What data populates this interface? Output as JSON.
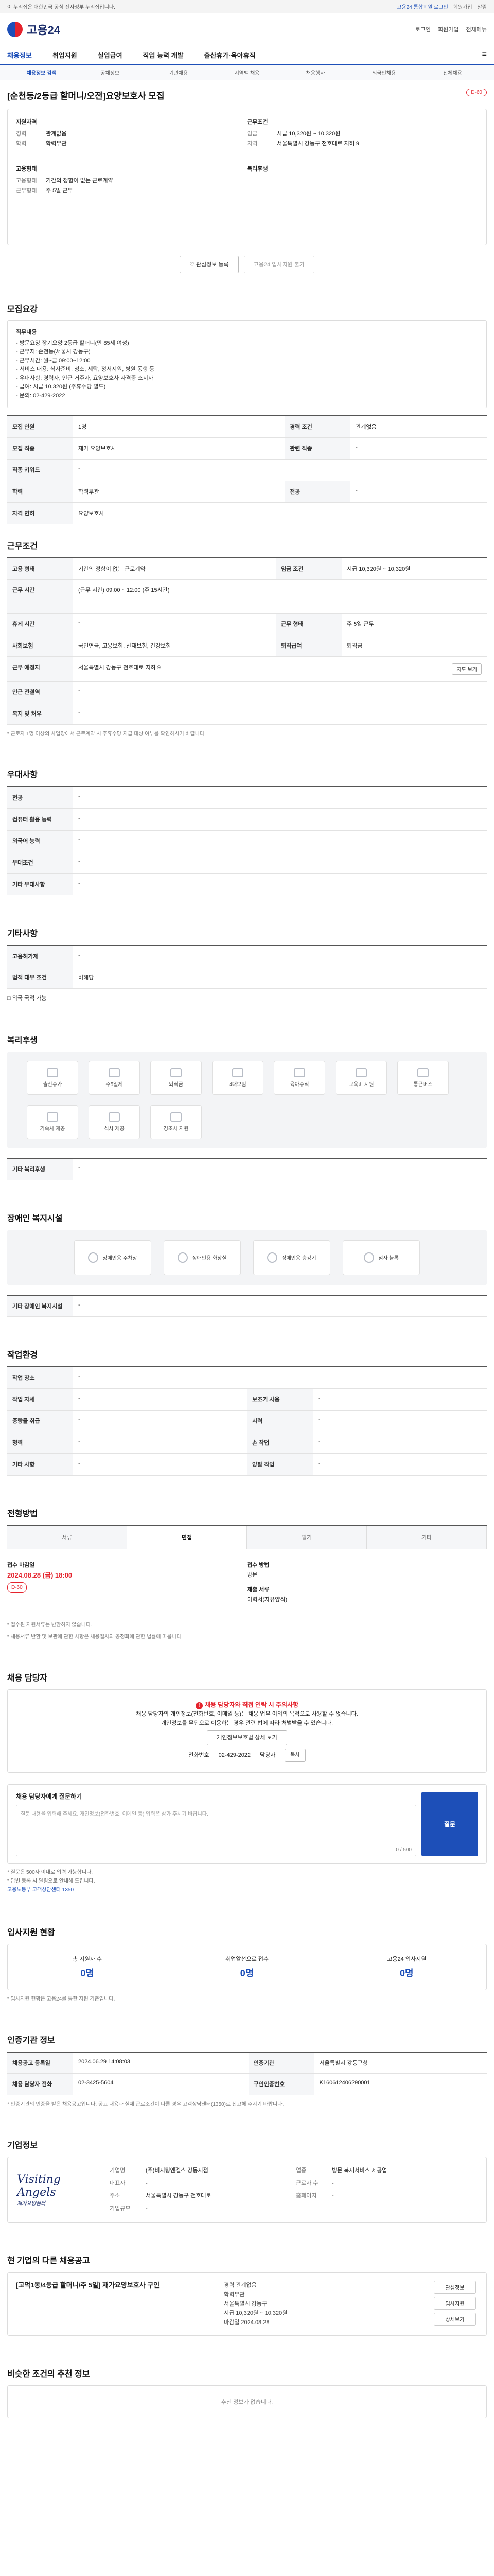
{
  "topbar": {
    "left": "이 누리집은 대한민국 공식 전자정부 누리집입니다.",
    "right": [
      "고용24 통합회원 로그인",
      "회원가입",
      "알림"
    ]
  },
  "header": {
    "logo_text": "고용24",
    "right_links": [
      "로그인",
      "회원가입",
      "전체메뉴"
    ]
  },
  "nav": {
    "items": [
      "채용정보",
      "취업지원",
      "실업급여",
      "직업 능력 개발",
      "출산휴가·육아휴직"
    ],
    "hamburger": "≡"
  },
  "subnav": {
    "items": [
      "채용정보 검색",
      "공채정보",
      "기관채용",
      "지역별 채용",
      "채용행사",
      "외국인채용",
      "전체채용"
    ]
  },
  "job": {
    "title": "[순천동/2등급 할머니/오전]요양보호사 모집",
    "badge": "D-60"
  },
  "summary": {
    "left": {
      "h1": "지원자격",
      "rows1": [
        [
          "경력",
          "관계없음"
        ],
        [
          "학력",
          "학력무관"
        ]
      ],
      "h2": "고용형태",
      "rows2": [
        [
          "고용형태",
          "기간의 정함이 없는 근로계약"
        ],
        [
          "근무형태",
          "주 5일 근무"
        ]
      ]
    },
    "right": {
      "h1": "근무조건",
      "rows1": [
        [
          "임금",
          "시급 10,320원 ~ 10,320원"
        ],
        [
          "지역",
          "서울특별시 강동구 천호대로 지하 9"
        ]
      ],
      "h2": "복리후생",
      "rows2": []
    }
  },
  "actions": {
    "save": "♡ 관심정보 등록",
    "compare": "고용24 입사지원 불가"
  },
  "detail": {
    "section_title": "모집요강",
    "job_desc_h": "직무내용",
    "job_desc_lines": [
      "- 방문요양 장기요양 2등급 할머니(만 85세 여성)",
      "- 근무지: 순천동(서울시 강동구)",
      "- 근무시간: 월~금 09:00~12:00",
      "- 서비스 내용: 식사준비, 청소, 세탁, 정서지원, 병원 동행 등",
      "- 우대사항: 경력자, 인근 거주자, 요양보호사 자격증 소지자",
      "- 급여: 시급 10,320원 (주휴수당 별도)",
      "- 문의: 02-429-2022"
    ],
    "rows": [
      [
        "모집 인원",
        "1명",
        "경력 조건",
        "관계없음"
      ],
      [
        "모집 직종",
        "재가 요양보호사",
        "관련 직종",
        "-"
      ],
      [
        "직종 키워드",
        "-",
        "",
        ""
      ],
      [
        "학력",
        "학력무관",
        "전공",
        "-"
      ],
      [
        "자격 면허",
        "요양보호사",
        "",
        ""
      ]
    ]
  },
  "conditions": {
    "section_title": "근무조건",
    "rows": [
      [
        "고용 형태",
        "기간의 정함이 없는 근로계약",
        "임금 조건",
        "시급 10,320원 ~ 10,320원"
      ],
      [
        "근무 시간",
        "(근무 시간) 09:00 ~ 12:00 (주 15시간)",
        "",
        ""
      ],
      [
        "휴게 시간",
        "-",
        "근무 형태",
        "주 5일 근무"
      ],
      [
        "사회보험",
        "국민연금, 고용보험, 산재보험, 건강보험",
        "퇴직급여",
        "퇴직금"
      ],
      [
        "근무 예정지",
        "서울특별시 강동구 천호대로 지하 9",
        "",
        ""
      ],
      [
        "인근 전철역",
        "-",
        "",
        ""
      ],
      [
        "복지 및 처우",
        "-",
        "",
        ""
      ]
    ],
    "map_btn": "지도 보기",
    "note": "* 근로자 1명 이상의 사업장에서 근로계약 시 주휴수당 지급 대상 여부를 확인하시기 바랍니다."
  },
  "preference": {
    "section_title": "우대사항",
    "rows": [
      [
        "전공",
        "-"
      ],
      [
        "컴퓨터 활용 능력",
        "-"
      ],
      [
        "외국어 능력",
        "-"
      ],
      [
        "우대조건",
        "-"
      ],
      [
        "기타 우대사항",
        "-"
      ]
    ]
  },
  "other": {
    "section_title": "기타사항",
    "rows": [
      [
        "고용허가제",
        "-"
      ],
      [
        "법적 대우 조건",
        "비해당"
      ]
    ],
    "check": "□ 외국 국적 가능"
  },
  "welfare": {
    "section_title": "복리후생",
    "tiles": [
      "출산휴가",
      "주5일제",
      "퇴직금",
      "4대보험",
      "육아휴직",
      "교육비 지원",
      "통근버스",
      "기숙사 제공",
      "식사 제공",
      "경조사 지원"
    ],
    "rows": [
      [
        "기타 복리후생",
        "-"
      ]
    ]
  },
  "disability": {
    "section_title": "장애인 복지시설",
    "tiles": [
      "장애인용 주차장",
      "장애인용 화장실",
      "장애인용 승강기",
      "점자 블록",
      "장애인 편의시설"
    ],
    "rows": [
      [
        "기타 장애인 복지시설",
        "-"
      ]
    ]
  },
  "workenv": {
    "section_title": "작업환경",
    "rows": [
      [
        "작업 장소",
        "-",
        "",
        ""
      ],
      [
        "작업 자세",
        "-",
        "보조기 사용",
        "-"
      ],
      [
        "중량물 취급",
        "-",
        "시력",
        "-"
      ],
      [
        "청력",
        "-",
        "손 작업",
        "-"
      ],
      [
        "기타 사항",
        "-",
        "양팔 작업",
        "-"
      ]
    ]
  },
  "process": {
    "section_title": "전형방법",
    "tabs": [
      "서류",
      "면접",
      "필기",
      "기타"
    ],
    "apply": {
      "h1": "접수 마감일",
      "due": "2024.08.28 (금) 18:00",
      "dday": "D-60",
      "h2": "접수 방법",
      "method1": "방문",
      "h3": "제출 서류",
      "method2": "이력서(자유양식)"
    },
    "notes": [
      "* 접수된 지원서류는 반환하지 않습니다.",
      "* 채용서류 반환 및 보관에 관한 사항은 채용절차의 공정화에 관한 법률에 따릅니다."
    ]
  },
  "contact": {
    "section_title": "채용 담당자",
    "warn_title": "채용 담당자와 직접 연락 시 주의사항",
    "warn_lines": [
      "채용 담당자의 개인정보(전화번호, 이메일 등)는 채용 업무 이외의 목적으로 사용할 수 없습니다.",
      "개인정보를 무단으로 이용하는 경우 관련 법에 따라 처벌받을 수 있습니다."
    ],
    "warn_btn": "개인정보보호법 상세 보기",
    "phone_label": "전화번호",
    "phone": "02-429-2022",
    "name_label": "담당자",
    "copy_btn": "복사"
  },
  "question": {
    "section_title": "채용 담당자에게 질문하기",
    "placeholder": "질문 내용을 입력해 주세요. 개인정보(전화번호, 이메일 등) 입력은 삼가 주시기 바랍니다.",
    "count": "0 / 500",
    "submit": "질문",
    "bullets": [
      "* 질문은 500자 이내로 입력 가능합니다.",
      "* 답변 등록 시 알림으로 안내해 드립니다."
    ],
    "link": "고용노동부 고객상담센터 1350"
  },
  "stats": {
    "section_title": "입사지원 현황",
    "items": [
      [
        "총 지원자 수",
        "0명"
      ],
      [
        "취업알선으로 접수",
        "0명"
      ],
      [
        "고용24 입사지원",
        "0명"
      ]
    ],
    "note": "* 입사지원 현황은 고용24를 통한 지원 기준입니다."
  },
  "inst": {
    "section_title": "인증기관 정보",
    "rows": [
      [
        "채용공고 등록일",
        "2024.06.29 14:08:03",
        "인증기관",
        "서울특별시 강동구청"
      ],
      [
        "채용 담당자 전화",
        "02-3425-5604",
        "구인인증번호",
        "K160612406290001"
      ]
    ],
    "note": "* 인증기관의 인증을 받은 채용공고입니다. 공고 내용과 실제 근로조건이 다른 경우 고객상담센터(1350)로 신고해 주시기 바랍니다."
  },
  "company": {
    "section_title": "기업정보",
    "logo_line1": "Visiting",
    "logo_line2": "Angels",
    "logo_line3": "재가요양센터",
    "rows": [
      [
        "기업명",
        "(주)비지팅엔젤스 강동지점",
        "업종",
        "방문 복지서비스 제공업"
      ],
      [
        "대표자",
        "-",
        "근로자 수",
        "-"
      ],
      [
        "주소",
        "서울특별시 강동구 천호대로",
        "홈페이지",
        "-"
      ],
      [
        "기업규모",
        "-",
        "",
        ""
      ]
    ]
  },
  "otherjobs": {
    "section_title": "현 기업의 다른 채용공고",
    "title": "[고덕1동/4등급 할머니/주 5일] 재가요양보호사 구인",
    "info": [
      "경력 관계없음",
      "학력무관",
      "서울특별시 강동구",
      "시급 10,320원 ~ 10,320원",
      "마감일 2024.08.28"
    ],
    "buttons": [
      "관심정보",
      "입사지원",
      "상세보기"
    ]
  },
  "similar": {
    "section_title": "비슷한 조건의 추천 정보",
    "empty": "추천 정보가 없습니다."
  }
}
